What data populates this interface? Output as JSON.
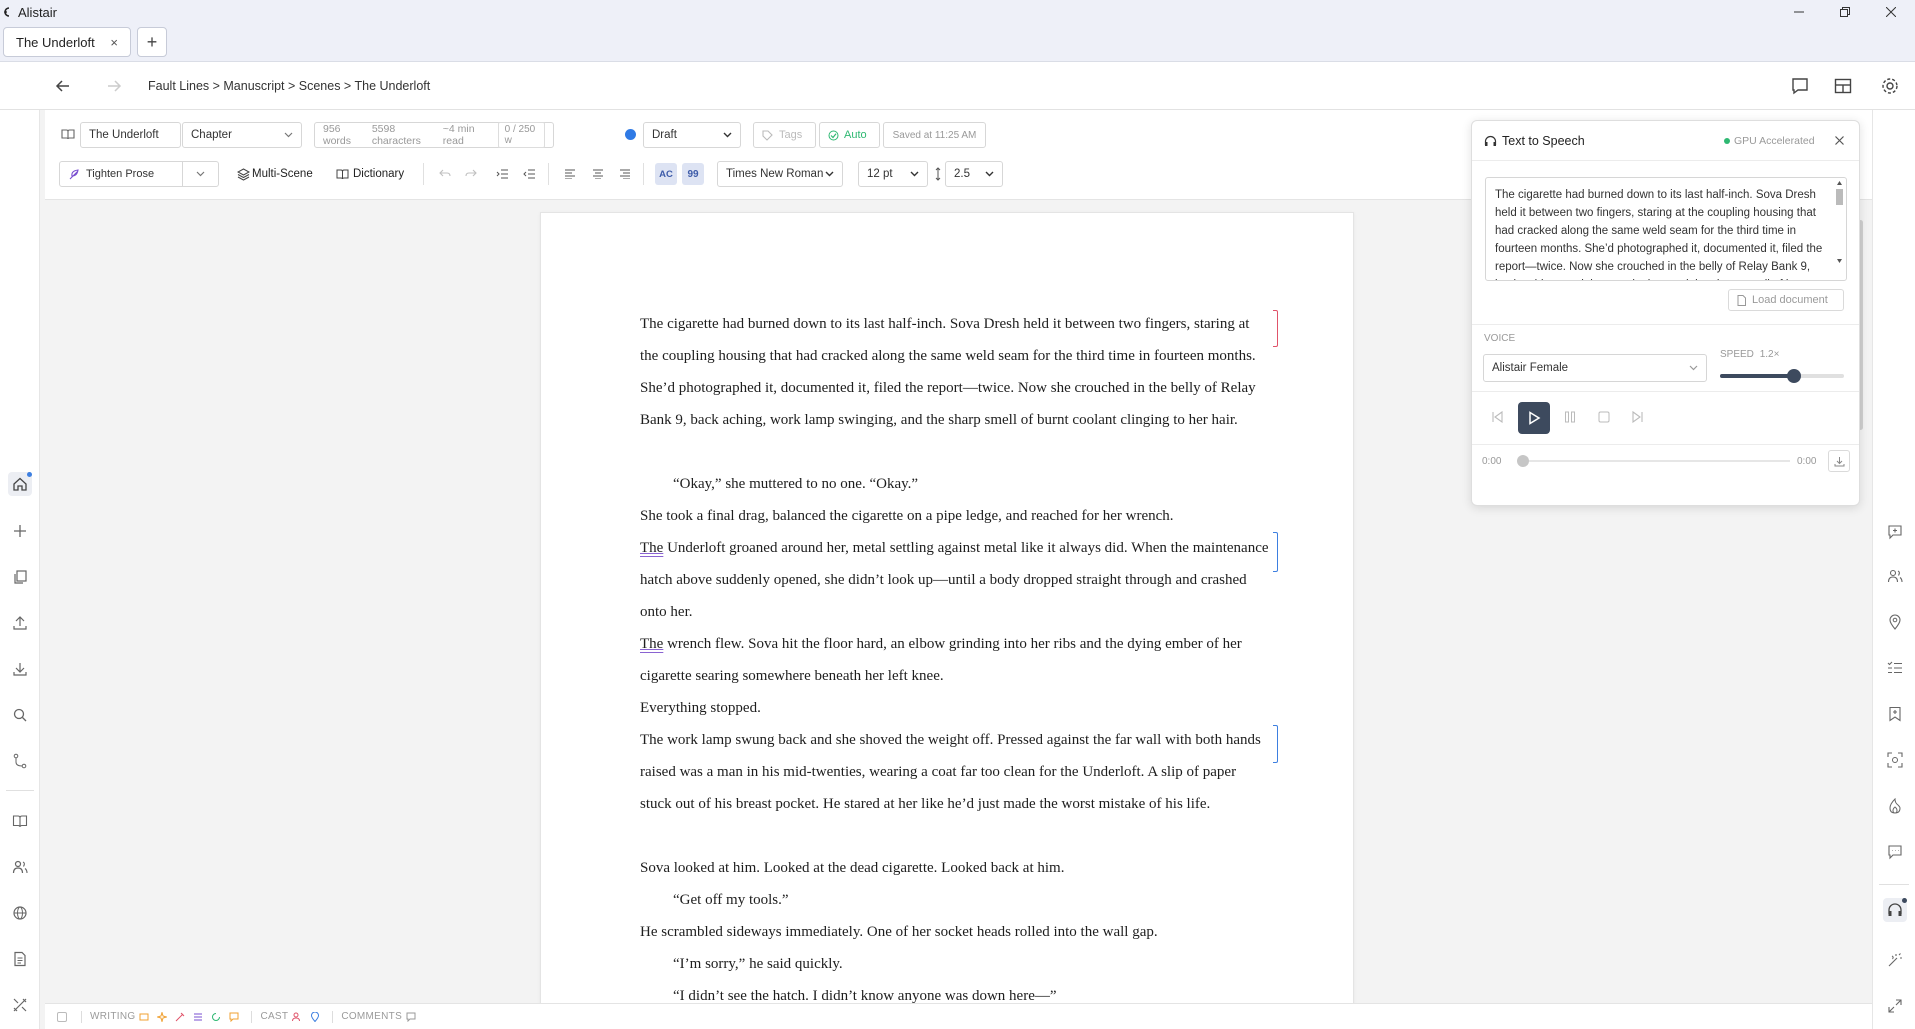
{
  "window": {
    "app_name": "Alistair",
    "tab_title": "The Underloft",
    "tab_close": "×",
    "new_tab": "+"
  },
  "nav": {
    "breadcrumb": "Fault Lines > Manuscript > Scenes > The Underloft"
  },
  "toolbar": {
    "doc_title": "The Underloft",
    "doc_type": "Chapter",
    "words": "956 words",
    "characters": "5598 characters",
    "read_time": "~4 min read",
    "goal": "0 / 250 w",
    "status": "Draft",
    "status_color": "#2f7ae5",
    "tags_placeholder": "Tags",
    "auto_label": "Auto",
    "saved": "Saved at 11:25 AM",
    "tighten_prose": "Tighten Prose",
    "multi_scene": "Multi-Scene",
    "dictionary": "Dictionary",
    "ac_label": "AC",
    "quote_label": "99",
    "font": "Times New Roman",
    "font_size": "12 pt",
    "line_height": "2.5"
  },
  "document": {
    "paragraphs": [
      {
        "text": "The cigarette had burned down to its last half-inch. Sova Dresh held it between two fingers, staring at the coupling housing that had cracked along the same weld seam for the third time in fourteen months. She’d photographed it, documented it, filed the report—twice. Now she crouched in the belly of Relay Bank 9, back aching, work lamp swinging, and the sharp smell of burnt coolant clinging to her hair."
      },
      {
        "text": "“Okay,” she muttered to no one. “Okay.”"
      },
      {
        "text": "She took a final drag, balanced the cigarette on a pipe ledge, and reached for her wrench."
      },
      {
        "first": "The",
        "text": " Underloft groaned around her, metal settling against metal like it always did. When the maintenance hatch above suddenly opened, she didn’t look up—until a body dropped straight through and crashed onto her."
      },
      {
        "first": "The",
        "text": " wrench flew. Sova hit the floor hard, an elbow grinding into her ribs and the dying ember of her cigarette searing somewhere beneath her left knee."
      },
      {
        "text": "Everything stopped."
      },
      {
        "text": "The work lamp swung back and she shoved the weight off. Pressed against the far wall with both hands raised was a man in his mid-twenties, wearing a coat far too clean for the Underloft. A slip of paper stuck out of his breast pocket. He stared at her like he’d just made the worst mistake of his life."
      },
      {
        "text": "Sova looked at him. Looked at the dead cigarette. Looked back at him."
      },
      {
        "text": "“Get off my tools.”"
      },
      {
        "text": "He scrambled sideways immediately. One of her socket heads rolled into the wall gap."
      },
      {
        "text": "“I’m sorry,” he said quickly."
      },
      {
        "text": "“I didn’t see the hatch. I didn’t know anyone was down here—”"
      }
    ],
    "margin_colors": [
      "#e0536a",
      "#3d7fe0",
      "#3d7fe0"
    ]
  },
  "tts": {
    "title": "Text to Speech",
    "gpu_label": "GPU Accelerated",
    "gpu_color": "#2eb872",
    "text": "The cigarette had burned down to its last half-inch. Sova Dresh held it between two fingers, staring at the coupling housing that had cracked along the same weld seam for the third time in fourteen months. She’d photographed it, documented it, filed the report—twice. Now she crouched in the belly of Relay Bank 9, back aching, work lamp swinging, and the sharp smell of burnt coolant clinging to her hair.",
    "load_document": "Load document",
    "voice_label": "VOICE",
    "voice": "Alistair Female",
    "speed_label": "SPEED",
    "speed_value": "1.2×",
    "speed_fraction": 0.6,
    "time_start": "0:00",
    "time_end": "0:00"
  },
  "statusbar": {
    "writing": "WRITING",
    "cast": "CAST",
    "comments": "COMMENTS"
  },
  "colors": {
    "accent": "#3d4a5e",
    "ac_bg": "#dde3f3",
    "auto_green": "#2eb872"
  }
}
